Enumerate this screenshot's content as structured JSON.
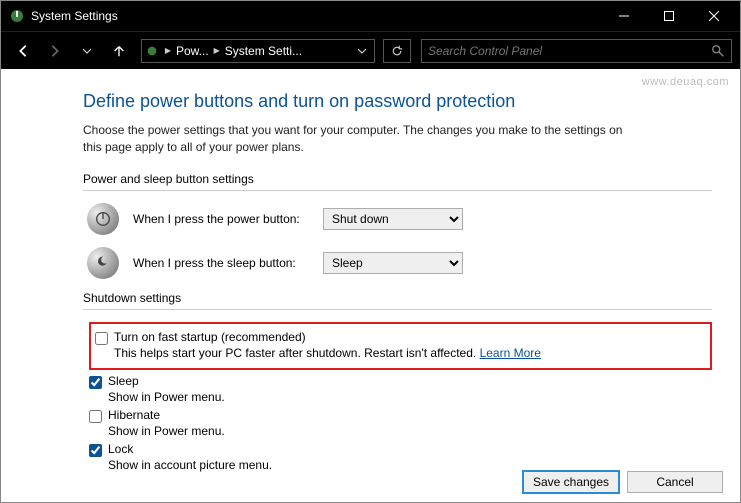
{
  "window": {
    "title": "System Settings"
  },
  "nav": {
    "breadcrumbs": [
      "Pow...",
      "System Setti..."
    ],
    "search_placeholder": "Search Control Panel"
  },
  "page": {
    "heading": "Define power buttons and turn on password protection",
    "intro": "Choose the power settings that you want for your computer. The changes you make to the settings on this page apply to all of your power plans."
  },
  "power_sleep": {
    "section_label": "Power and sleep button settings",
    "power_label": "When I press the power button:",
    "power_value": "Shut down",
    "sleep_label": "When I press the sleep button:",
    "sleep_value": "Sleep"
  },
  "shutdown": {
    "section_label": "Shutdown settings",
    "fast_startup": {
      "label": "Turn on fast startup (recommended)",
      "desc_a": "This helps start your PC faster after shutdown. Restart isn't affected. ",
      "learn_more": "Learn More"
    },
    "sleep": {
      "label": "Sleep",
      "desc": "Show in Power menu."
    },
    "hibernate": {
      "label": "Hibernate",
      "desc": "Show in Power menu."
    },
    "lock": {
      "label": "Lock",
      "desc": "Show in account picture menu."
    }
  },
  "footer": {
    "save": "Save changes",
    "cancel": "Cancel"
  },
  "watermark": "www.deuaq.com"
}
